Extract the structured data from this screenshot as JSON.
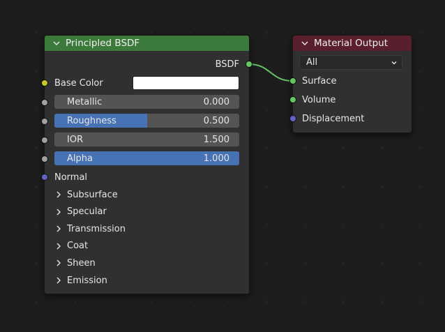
{
  "colors": {
    "background": "#1d1d1d",
    "node_body": "#303030",
    "shader_header": "#3b7a3b",
    "output_header": "#5a1f2c",
    "shader_socket": "#63c763",
    "color_socket": "#c7c729",
    "float_socket": "#a1a1a1",
    "vector_socket": "#6363c7",
    "slider_fill": "#4772b3",
    "field_bg": "#545454"
  },
  "bsdf_node": {
    "title": "Principled BSDF",
    "output_label": "BSDF",
    "base_color_label": "Base Color",
    "base_color_value": "#ffffff",
    "inputs": [
      {
        "label": "Metallic",
        "value": "0.000",
        "fill": 0.0
      },
      {
        "label": "Roughness",
        "value": "0.500",
        "fill": 0.5
      },
      {
        "label": "IOR",
        "value": "1.500",
        "fill": 0.0
      },
      {
        "label": "Alpha",
        "value": "1.000",
        "fill": 1.0
      }
    ],
    "normal_label": "Normal",
    "panels": [
      "Subsurface",
      "Specular",
      "Transmission",
      "Coat",
      "Sheen",
      "Emission"
    ]
  },
  "output_node": {
    "title": "Material Output",
    "target": "All",
    "inputs": [
      "Surface",
      "Volume",
      "Displacement"
    ]
  }
}
